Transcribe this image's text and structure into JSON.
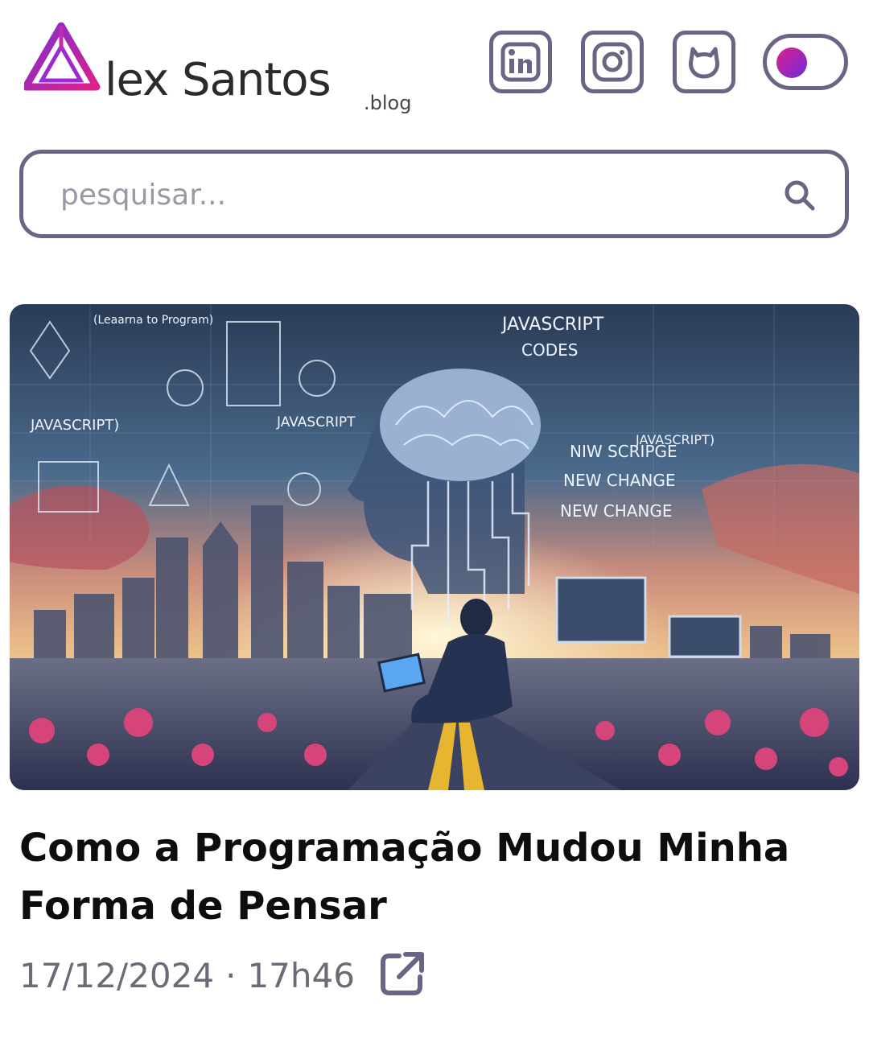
{
  "brand": {
    "name": "lex Santos",
    "suffix": ".blog",
    "mark": "A"
  },
  "header": {
    "social": [
      {
        "icon": "linkedin-icon",
        "label": "LinkedIn"
      },
      {
        "icon": "instagram-icon",
        "label": "Instagram"
      },
      {
        "icon": "github-icon",
        "label": "GitHub"
      }
    ],
    "theme_toggle": {
      "state": "on"
    }
  },
  "search": {
    "placeholder": "pesquisar...",
    "value": ""
  },
  "post": {
    "image_text": {
      "learn": "(Leaarna to Program)",
      "js1": "JAVASCRIPT",
      "js_codes": "JAVASCRIPT",
      "codes": "CODES",
      "js_left": "JAVASCRIPT)",
      "js_mid": "JAVASCRIPT",
      "js_right": "JAVASCRIPT)",
      "new_script": "NIW SCRIPGE",
      "new_change1": "NEW CHANGE",
      "new_change2": "NEW CHANGE"
    },
    "title": "Como a Programação Mudou Minha Forma de Pensar",
    "date": "17/12/2024",
    "separator": "·",
    "time": "17h46"
  },
  "colors": {
    "border": "#6b6585",
    "accent_pink": "#e0208a",
    "accent_purple": "#6a2bdc",
    "meta_text": "#6b6b78"
  }
}
